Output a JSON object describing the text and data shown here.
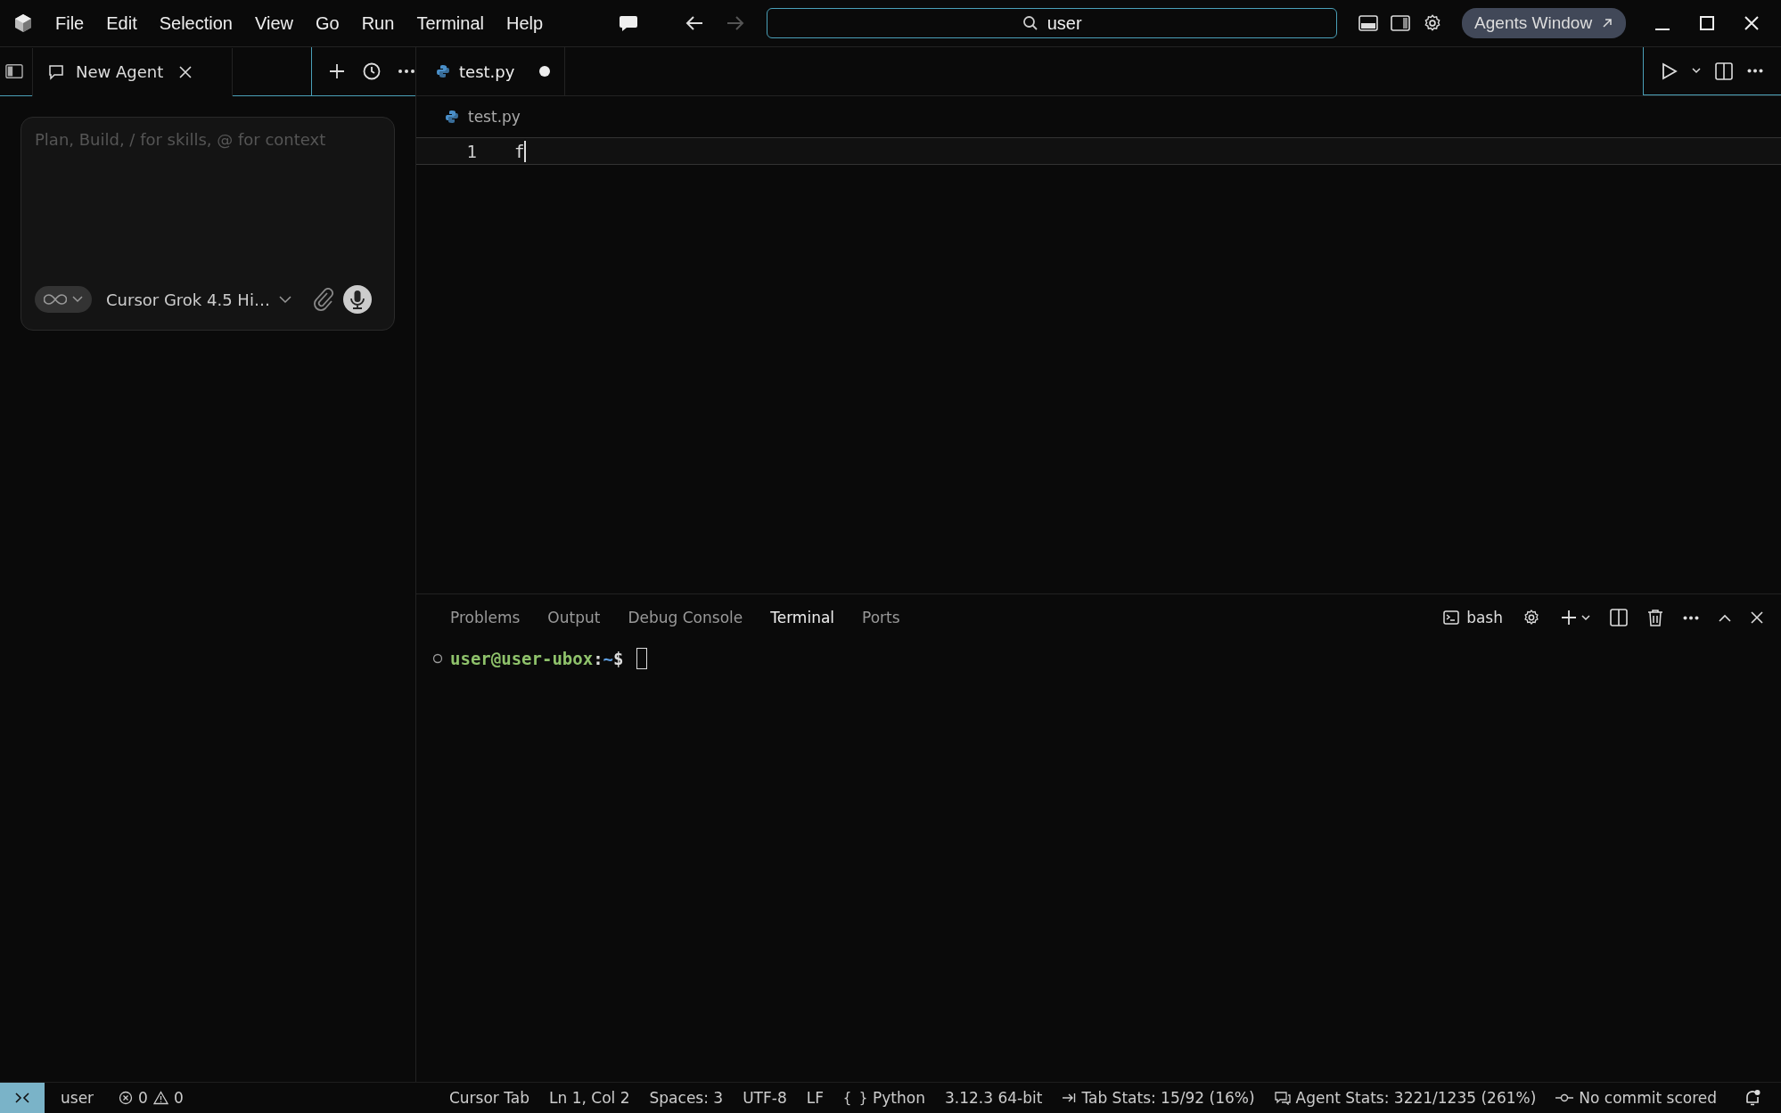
{
  "menu": [
    "File",
    "Edit",
    "Selection",
    "View",
    "Go",
    "Run",
    "Terminal",
    "Help"
  ],
  "search": {
    "value": "user"
  },
  "agents_window_button": "Agents Window",
  "agent_tab": {
    "title": "New Agent"
  },
  "composer": {
    "placeholder": "Plan, Build, / for skills, @ for context",
    "model": "Cursor Grok 4.5 Hi…"
  },
  "editor_tabs": [
    {
      "name": "test.py",
      "modified": true,
      "selected": true
    }
  ],
  "breadcrumb": "test.py",
  "code_lines": [
    {
      "number": "1",
      "text": "f"
    }
  ],
  "panel_tabs": [
    {
      "label": "Problems",
      "selected": false
    },
    {
      "label": "Output",
      "selected": false
    },
    {
      "label": "Debug Console",
      "selected": false
    },
    {
      "label": "Terminal",
      "selected": true
    },
    {
      "label": "Ports",
      "selected": false
    }
  ],
  "terminal_shell": "bash",
  "terminal_prompt": [
    {
      "kind": "user",
      "text": "user@user-ubox"
    },
    {
      "kind": "plain",
      "text": ":"
    },
    {
      "kind": "path",
      "text": "~"
    },
    {
      "kind": "plain",
      "text": "$"
    }
  ],
  "status_bar": {
    "user": "user",
    "errors": "0",
    "warnings": "0",
    "items": [
      {
        "kind": "text",
        "text": "Cursor Tab"
      },
      {
        "kind": "text",
        "text": "Ln 1, Col 2"
      },
      {
        "kind": "text",
        "text": "Spaces: 3"
      },
      {
        "kind": "text",
        "text": "UTF-8"
      },
      {
        "kind": "text",
        "text": "LF"
      },
      {
        "kind": "braces",
        "text": "Python",
        "glyph": "{ }"
      },
      {
        "kind": "text",
        "text": "3.12.3 64-bit"
      },
      {
        "kind": "tab",
        "text": "Tab Stats: 15/92 (16%)"
      },
      {
        "kind": "agent",
        "text": "Agent Stats: 3221/1235 (261%)"
      },
      {
        "kind": "commit",
        "text": "No commit scored"
      }
    ]
  }
}
